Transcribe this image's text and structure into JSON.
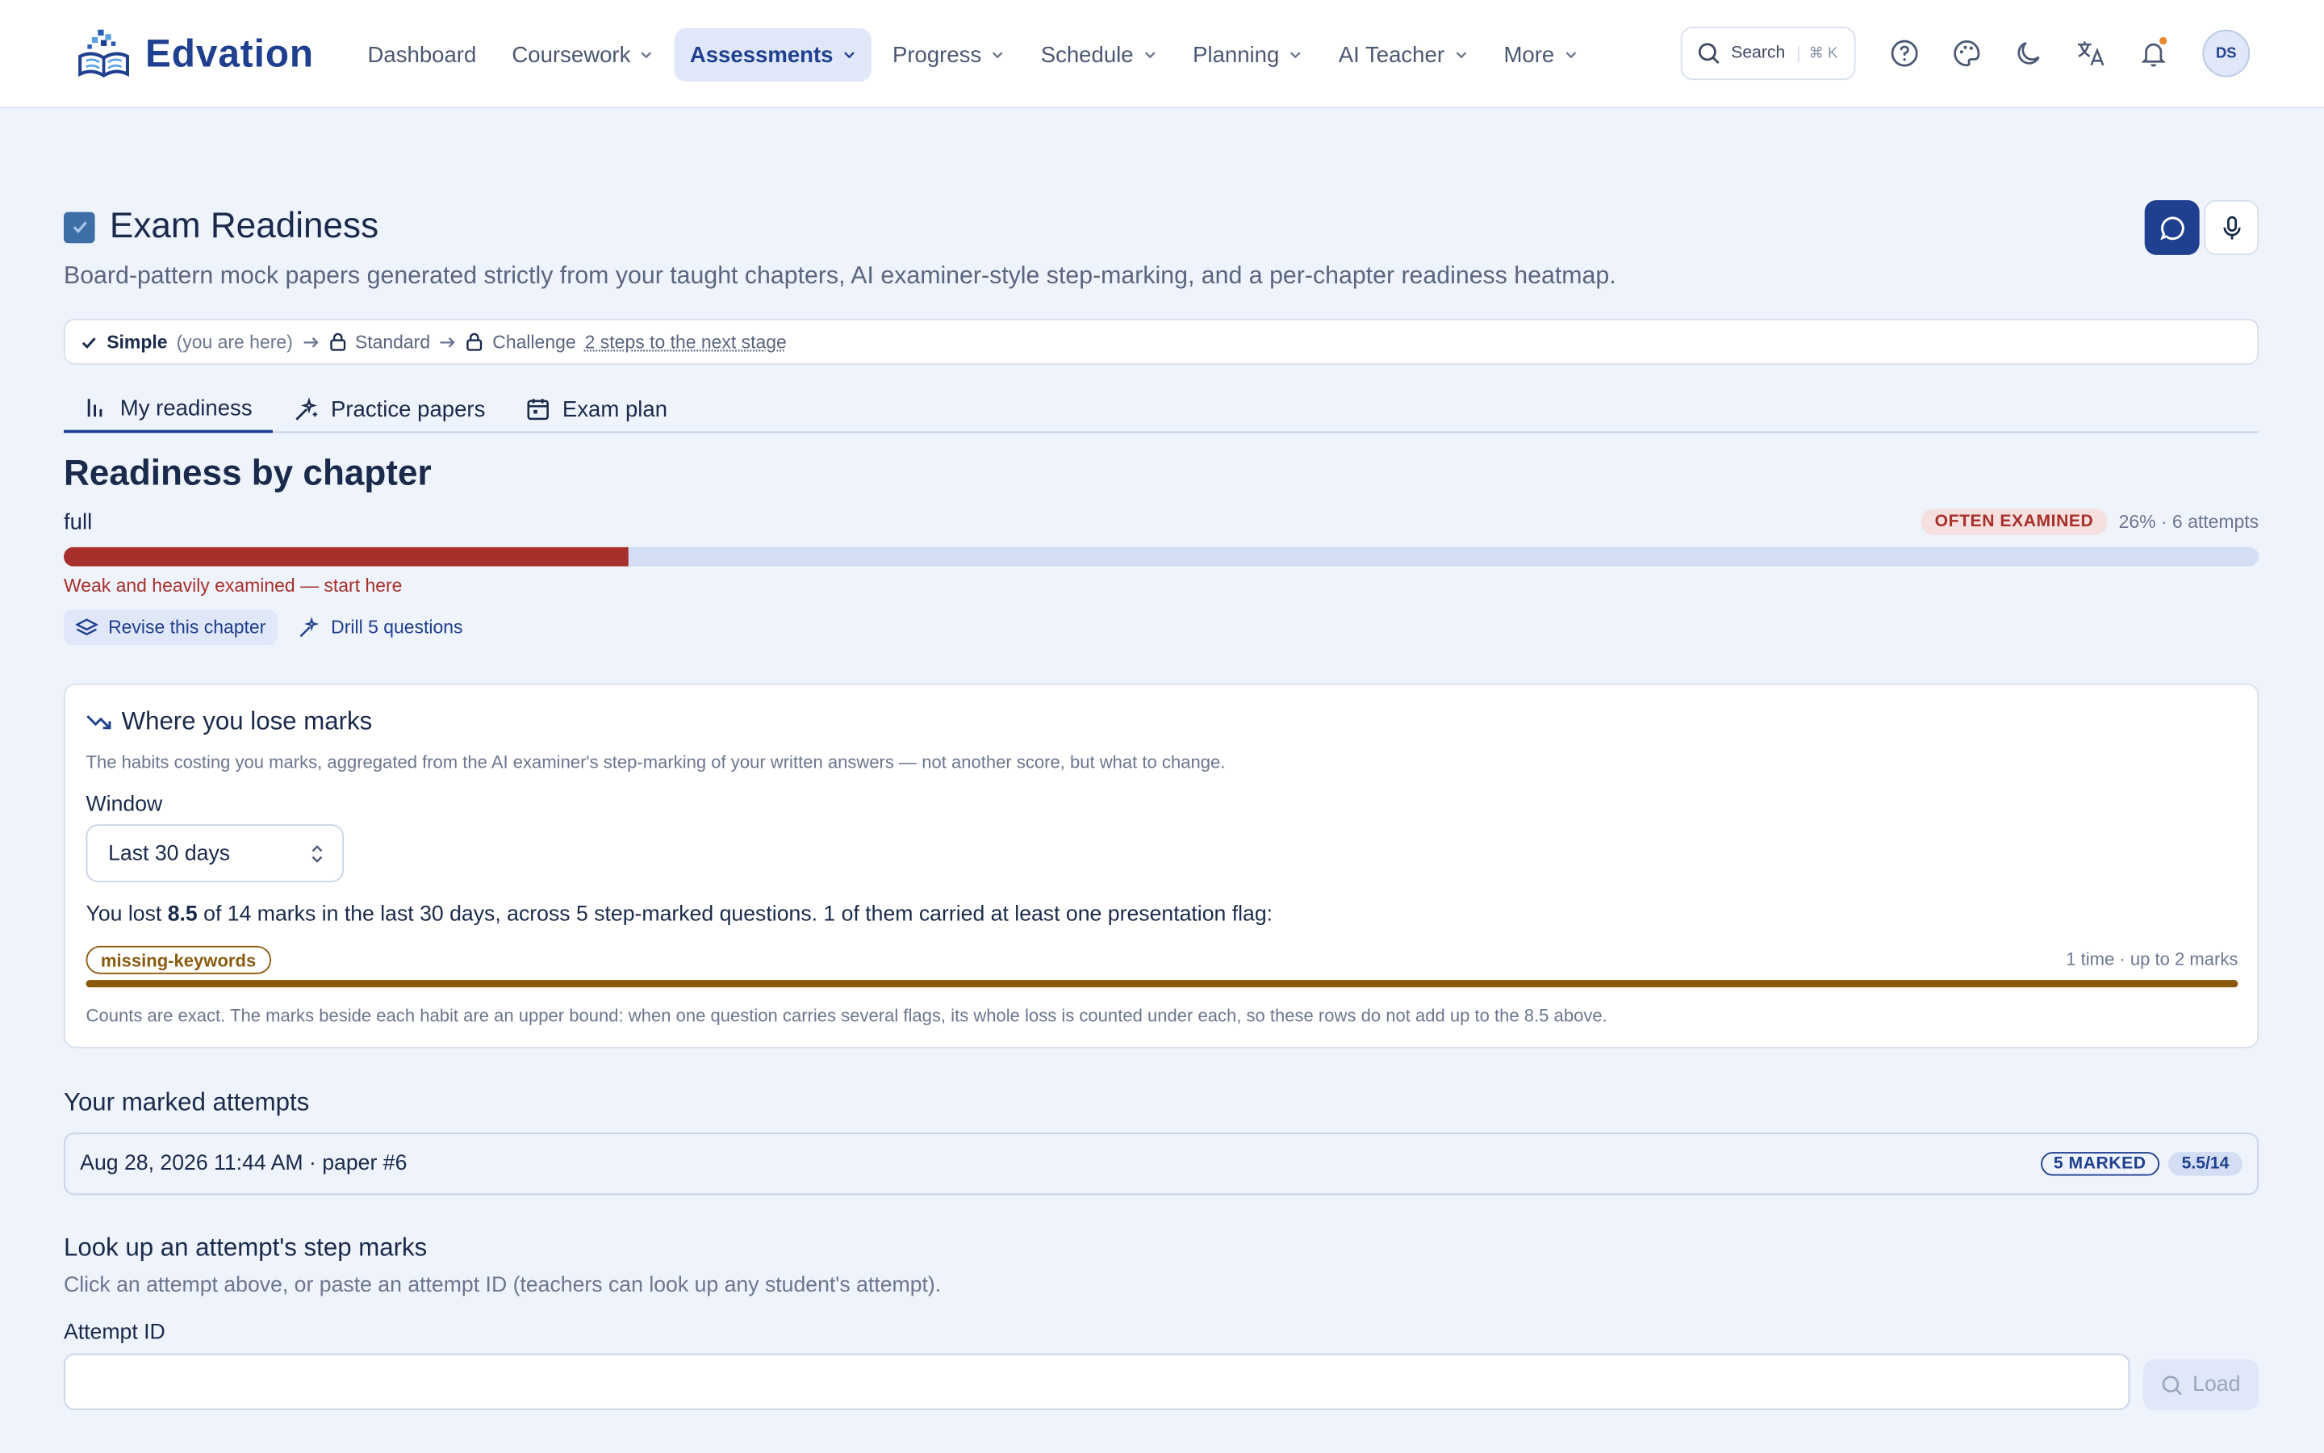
{
  "brand": {
    "name": "Edvation"
  },
  "nav": {
    "items": [
      {
        "label": "Dashboard",
        "dropdown": false
      },
      {
        "label": "Coursework",
        "dropdown": true
      },
      {
        "label": "Assessments",
        "dropdown": true,
        "active": true
      },
      {
        "label": "Progress",
        "dropdown": true
      },
      {
        "label": "Schedule",
        "dropdown": true
      },
      {
        "label": "Planning",
        "dropdown": true
      },
      {
        "label": "AI Teacher",
        "dropdown": true
      },
      {
        "label": "More",
        "dropdown": true
      }
    ],
    "search_label": "Search",
    "search_shortcut": "⌘ K",
    "avatar_initials": "DS"
  },
  "header": {
    "title": "Exam Readiness",
    "subtitle": "Board-pattern mock papers generated strictly from your taught chapters, AI examiner-style step-marking, and a per-chapter readiness heatmap."
  },
  "stages": {
    "current": "Simple",
    "current_note": "(you are here)",
    "next": "Standard",
    "final": "Challenge",
    "hint": "2 steps to the next stage"
  },
  "tabs": [
    {
      "label": "My readiness",
      "icon": "bar-chart-icon",
      "active": true
    },
    {
      "label": "Practice papers",
      "icon": "sparkle-icon",
      "active": false
    },
    {
      "label": "Exam plan",
      "icon": "calendar-icon",
      "active": false
    }
  ],
  "readiness": {
    "section_title": "Readiness by chapter",
    "chapter_name": "full",
    "badge": "OFTEN EXAMINED",
    "meta": "26% · 6 attempts",
    "percent": 0.257,
    "warning": "Weak and heavily examined — start here",
    "revise_label": "Revise this chapter",
    "drill_label": "Drill 5 questions"
  },
  "marks_card": {
    "title": "Where you lose marks",
    "description": "The habits costing you marks, aggregated from the AI examiner's step-marking of your written answers — not another score, but what to change.",
    "window_label": "Window",
    "window_value": "Last 30 days",
    "summary_prefix": "You lost ",
    "summary_lost": "8.5",
    "summary_suffix": " of 14 marks in the last 30 days, across 5 step-marked questions. 1 of them carried at least one presentation flag:",
    "flag_label": "missing-keywords",
    "flag_meta": "1 time · up to 2 marks",
    "flag_fraction": 1.0,
    "footnote": "Counts are exact. The marks beside each habit are an upper bound: when one question carries several flags, its whole loss is counted under each, so these rows do not add up to the 8.5 above."
  },
  "attempts": {
    "title": "Your marked attempts",
    "rows": [
      {
        "label": "Aug 28, 2026 11:44 AM · paper #6",
        "status": "5 MARKED",
        "score": "5.5/14"
      }
    ]
  },
  "lookup": {
    "title": "Look up an attempt's step marks",
    "description": "Click an attempt above, or paste an attempt ID (teachers can look up any student's attempt).",
    "field_label": "Attempt ID",
    "input_value": "",
    "input_placeholder": "",
    "button_label": "Load"
  },
  "colors": {
    "accent": "#1f3f8f",
    "danger": "#a8302a",
    "flag": "#8a5a0f",
    "background": "#eef3fc"
  }
}
